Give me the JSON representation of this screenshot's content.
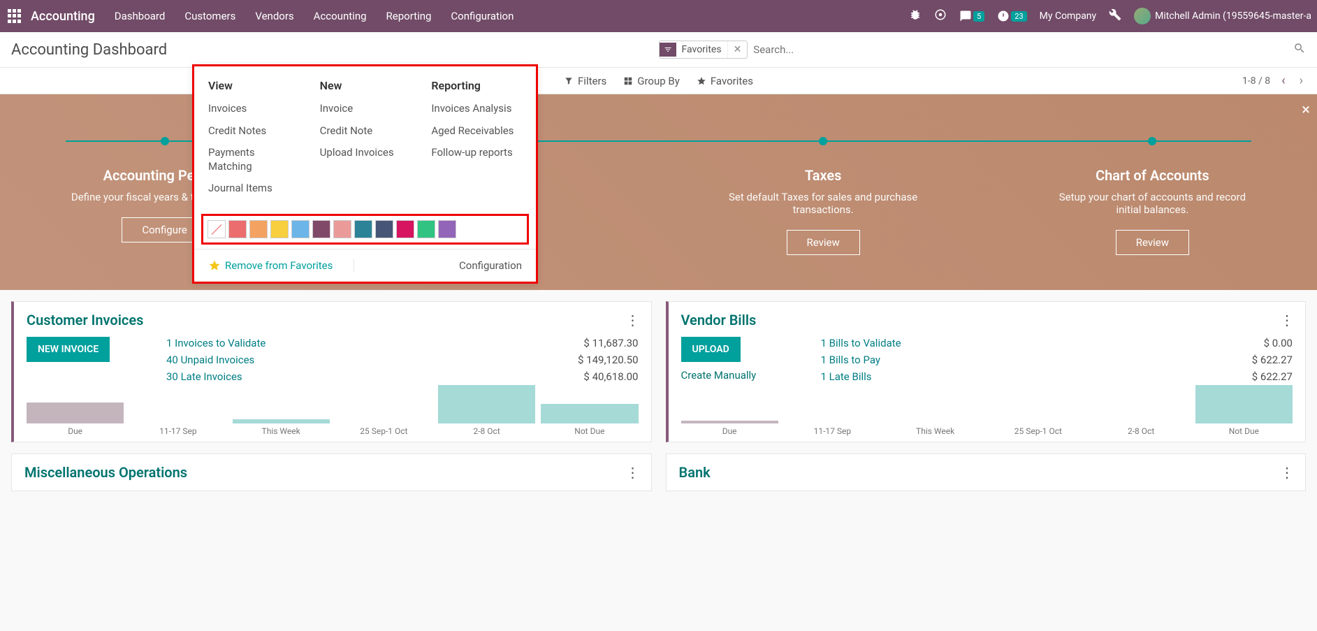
{
  "nav": {
    "brand": "Accounting",
    "items": [
      "Dashboard",
      "Customers",
      "Vendors",
      "Accounting",
      "Reporting",
      "Configuration"
    ],
    "msg_badge": "5",
    "clock_badge": "23",
    "company": "My Company",
    "user": "Mitchell Admin (19559645-master-a"
  },
  "page": {
    "title": "Accounting Dashboard",
    "chip_label": "Favorites",
    "search_placeholder": "Search...",
    "filters": "Filters",
    "groupby": "Group By",
    "favorites": "Favorites",
    "pager": "1-8 / 8"
  },
  "popup": {
    "h_view": "View",
    "h_new": "New",
    "h_report": "Reporting",
    "view_items": [
      "Invoices",
      "Credit Notes",
      "Payments Matching",
      "Journal Items"
    ],
    "new_items": [
      "Invoice",
      "Credit Note",
      "Upload Invoices"
    ],
    "report_items": [
      "Invoices Analysis",
      "Aged Receivables",
      "Follow-up reports"
    ],
    "colors": [
      "#fff",
      "#eb6d6d",
      "#f4a261",
      "#f7cf3f",
      "#6cb5e8",
      "#814968",
      "#eb9a9a",
      "#2c8397",
      "#475577",
      "#d6145f",
      "#30c381",
      "#9365b8"
    ],
    "remove_fav": "Remove from Favorites",
    "configuration": "Configuration"
  },
  "hero": {
    "cards": [
      {
        "title": "Accounting Periods",
        "desc": "Define your fiscal years & tax periodicity.",
        "btn": "Configure"
      },
      {
        "title": "",
        "desc": "",
        "btn": ""
      },
      {
        "title": "Taxes",
        "desc": "Set default Taxes for sales and purchase transactions.",
        "btn": "Review"
      },
      {
        "title": "Chart of Accounts",
        "desc": "Setup your chart of accounts and record initial balances.",
        "btn": "Review"
      }
    ]
  },
  "card_inv": {
    "title": "Customer Invoices",
    "btn": "NEW INVOICE",
    "rows": [
      {
        "label": "1 Invoices to Validate",
        "val": "$ 11,687.30"
      },
      {
        "label": "40 Unpaid Invoices",
        "val": "$ 149,120.50"
      },
      {
        "label": "30 Late Invoices",
        "val": "$ 40,618.00"
      }
    ]
  },
  "card_bills": {
    "title": "Vendor Bills",
    "btn": "UPLOAD",
    "create": "Create Manually",
    "rows": [
      {
        "label": "1 Bills to Validate",
        "val": "$ 0.00"
      },
      {
        "label": "1 Bills to Pay",
        "val": "$ 622.27"
      },
      {
        "label": "1 Late Bills",
        "val": "$ 622.27"
      }
    ]
  },
  "chart_labels": [
    "Due",
    "11-17 Sep",
    "This Week",
    "25 Sep-1 Oct",
    "2-8 Oct",
    "Not Due"
  ],
  "card_misc": "Miscellaneous Operations",
  "card_bank": "Bank",
  "chart_data": [
    {
      "type": "bar",
      "title": "Customer Invoices",
      "categories": [
        "Due",
        "11-17 Sep",
        "This Week",
        "25 Sep-1 Oct",
        "2-8 Oct",
        "Not Due"
      ],
      "values": [
        30,
        0,
        6,
        0,
        55,
        28
      ]
    },
    {
      "type": "bar",
      "title": "Vendor Bills",
      "categories": [
        "Due",
        "11-17 Sep",
        "This Week",
        "25 Sep-1 Oct",
        "2-8 Oct",
        "Not Due"
      ],
      "values": [
        4,
        0,
        0,
        0,
        0,
        55
      ]
    }
  ]
}
